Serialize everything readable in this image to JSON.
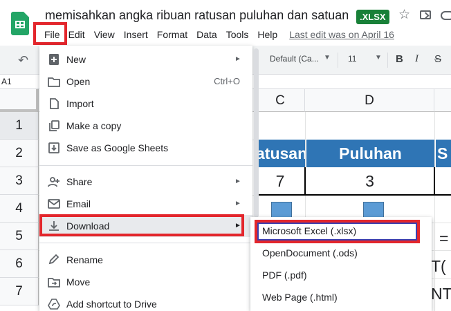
{
  "header": {
    "doc_title": "memisahkan angka ribuan ratusan puluhan dan satuan",
    "format_badge": ".XLSX",
    "menubar": [
      "Edit",
      "View",
      "Insert",
      "Format",
      "Data",
      "Tools",
      "Help"
    ],
    "file_menu_label": "File",
    "last_edit": "Last edit was on April 16"
  },
  "toolbar": {
    "font_name": "Default (Ca...",
    "font_size": "11",
    "bold": "B",
    "italic": "I",
    "strike": "S"
  },
  "formula_bar": {
    "name_box": "A1"
  },
  "grid": {
    "columns": [
      "C",
      "D"
    ],
    "rows": [
      "1",
      "2",
      "3",
      "4",
      "5",
      "6",
      "7"
    ],
    "header_cells": [
      "atusan",
      "Puluhan",
      "S"
    ],
    "value_cells": [
      "7",
      "3"
    ],
    "partial_text": {
      "row5": "=",
      "row6": "T(",
      "row7": "NT"
    }
  },
  "file_menu": {
    "items": [
      {
        "label": "New",
        "icon": "add-icon",
        "submenu": true
      },
      {
        "label": "Open",
        "icon": "folder-icon",
        "shortcut": "Ctrl+O"
      },
      {
        "label": "Import",
        "icon": "document-icon"
      },
      {
        "label": "Make a copy",
        "icon": "copy-icon"
      },
      {
        "label": "Save as Google Sheets",
        "icon": "save-down-icon"
      },
      {
        "label": "Share",
        "icon": "person-add-icon",
        "submenu": true
      },
      {
        "label": "Email",
        "icon": "email-icon",
        "submenu": true
      },
      {
        "label": "Download",
        "icon": "download-icon",
        "submenu": true
      },
      {
        "label": "Rename",
        "icon": "pencil-icon"
      },
      {
        "label": "Move",
        "icon": "move-folder-icon"
      },
      {
        "label": "Add shortcut to Drive",
        "icon": "drive-shortcut-icon"
      }
    ]
  },
  "download_menu": {
    "items": [
      "Microsoft Excel (.xlsx)",
      "OpenDocument (.ods)",
      "PDF (.pdf)",
      "Web Page (.html)"
    ]
  },
  "colors": {
    "highlight_red": "#e3262c",
    "highlight_blue": "#3a3fb0",
    "header_blue": "#2f75b5",
    "sheets_green": "#23a566"
  }
}
